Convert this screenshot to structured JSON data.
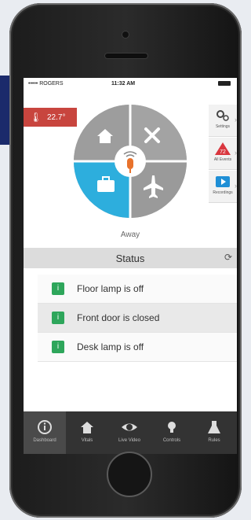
{
  "status_bar": {
    "carrier": "••••• ROGERS",
    "time": "11:32 AM"
  },
  "temperature": {
    "value": "22.7°"
  },
  "mode_wheel": {
    "selected_mode": "Away",
    "icons": [
      "home-icon",
      "close-icon",
      "briefcase-icon",
      "airplane-icon",
      "microphone-icon"
    ]
  },
  "side_panel": {
    "settings_label": "Settings",
    "alerts_count": "72",
    "alerts_label": "All Events",
    "recordings_label": "Recordings"
  },
  "status_section": {
    "title": "Status",
    "items": [
      {
        "text": "Floor lamp is off"
      },
      {
        "text": "Front door is closed"
      },
      {
        "text": "Desk lamp is off"
      }
    ]
  },
  "tabs": [
    {
      "label": "Dashboard",
      "icon": "info-icon",
      "active": true
    },
    {
      "label": "Vitals",
      "icon": "house-icon",
      "active": false
    },
    {
      "label": "Live Video",
      "icon": "eye-icon",
      "active": false
    },
    {
      "label": "Controls",
      "icon": "bulb-icon",
      "active": false
    },
    {
      "label": "Rules",
      "icon": "flask-icon",
      "active": false
    }
  ],
  "colors": {
    "accent_blue": "#2daedd",
    "alert_red": "#c8453e",
    "status_green": "#2ea65b",
    "mic_orange": "#e8722c"
  }
}
